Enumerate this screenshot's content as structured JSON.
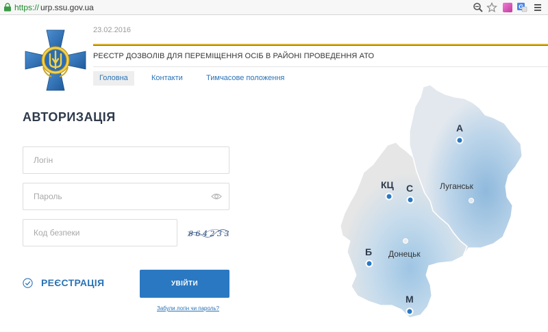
{
  "browser": {
    "url_scheme": "https://",
    "url_host": "urp.ssu.gov.ua"
  },
  "header": {
    "date": "23.02.2016",
    "registry_title": "РЕЄСТР ДОЗВОЛІВ ДЛЯ ПЕРЕМІЩЕННЯ ОСІБ В РАЙОНІ ПРОВЕДЕННЯ АТО"
  },
  "nav": {
    "items": [
      {
        "label": "Головна",
        "active": true
      },
      {
        "label": "Контакти",
        "active": false
      },
      {
        "label": "Тимчасове положення",
        "active": false
      }
    ]
  },
  "auth": {
    "title": "АВТОРИЗАЦІЯ",
    "login_placeholder": "Логін",
    "password_placeholder": "Пароль",
    "captcha_placeholder": "Код безпеки",
    "captcha_code": "8 6 4 2 3 3",
    "register_label": "РЕЄСТРАЦІЯ",
    "submit_label": "УВІЙТИ",
    "forgot_label": "Забули логін чи пароль?"
  },
  "map": {
    "cities": [
      {
        "label": "Луганськ"
      },
      {
        "label": "Донецьк"
      }
    ],
    "checkpoints": [
      "А",
      "КЦ",
      "С",
      "Б",
      "М"
    ]
  },
  "colors": {
    "accent": "#2b78c2",
    "link": "#2a72b5",
    "map_fill": "#e6e6e6",
    "map_gradient": "#9cc3e0",
    "emblem_blue": "#2a6db3",
    "flag_yellow": "#d9b334"
  }
}
